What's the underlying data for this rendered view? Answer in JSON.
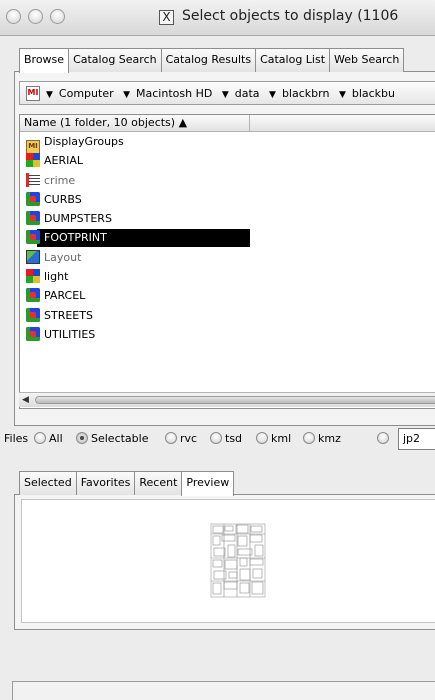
{
  "window": {
    "title": "Select objects to display (1106",
    "title_icon": "X"
  },
  "tabs_top": [
    {
      "label": "Browse",
      "active": true
    },
    {
      "label": "Catalog Search",
      "active": false
    },
    {
      "label": "Catalog Results",
      "active": false
    },
    {
      "label": "Catalog List",
      "active": false
    },
    {
      "label": "Web Search",
      "active": false
    }
  ],
  "breadcrumb": {
    "icon_label": "MI",
    "items": [
      "Computer",
      "Macintosh HD",
      "data",
      "blackbrn",
      "blackbu"
    ]
  },
  "list": {
    "header": "Name (1 folder, 10 objects) ▲",
    "rows": [
      {
        "name": "DisplayGroups",
        "icon": "folder-icon",
        "dim": false,
        "selected": false
      },
      {
        "name": "AERIAL",
        "icon": "raster-icon",
        "dim": false,
        "selected": false
      },
      {
        "name": "crime",
        "icon": "table-icon",
        "dim": true,
        "selected": false
      },
      {
        "name": "CURBS",
        "icon": "vector-icon",
        "dim": false,
        "selected": false
      },
      {
        "name": "DUMPSTERS",
        "icon": "vector-icon",
        "dim": false,
        "selected": false
      },
      {
        "name": "FOOTPRINT",
        "icon": "vector-icon",
        "dim": false,
        "selected": true
      },
      {
        "name": "Layout",
        "icon": "layout-icon",
        "dim": true,
        "selected": false
      },
      {
        "name": "light",
        "icon": "raster-icon",
        "dim": false,
        "selected": false
      },
      {
        "name": "PARCEL",
        "icon": "vector-icon",
        "dim": false,
        "selected": false
      },
      {
        "name": "STREETS",
        "icon": "vector-icon",
        "dim": false,
        "selected": false
      },
      {
        "name": "UTILITIES",
        "icon": "vector-icon",
        "dim": false,
        "selected": false
      }
    ]
  },
  "files_filter": {
    "label": "Files",
    "options": [
      {
        "label": "All",
        "selected": false
      },
      {
        "label": "Selectable",
        "selected": true
      },
      {
        "label": "rvc",
        "selected": false
      },
      {
        "label": "tsd",
        "selected": false
      },
      {
        "label": "kml",
        "selected": false
      },
      {
        "label": "kmz",
        "selected": false
      },
      {
        "label": "",
        "selected": false
      }
    ],
    "extension_value": "jp2"
  },
  "tabs_bottom": [
    {
      "label": "Selected",
      "active": false
    },
    {
      "label": "Favorites",
      "active": false
    },
    {
      "label": "Recent",
      "active": false
    },
    {
      "label": "Preview",
      "active": true
    }
  ]
}
